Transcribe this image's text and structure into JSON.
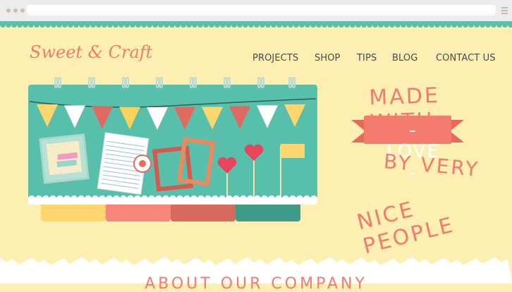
{
  "site": {
    "logo": "Sweet & Craft",
    "nav": [
      "PROJECTS",
      "SHOP",
      "TIPS",
      "BLOG",
      "CONTACT US"
    ]
  },
  "hero": {
    "line1": "MADE WITH",
    "ribbon": "- LOVE -",
    "line2": "BY VERY",
    "line3": "NICE PEOPLE"
  },
  "section": {
    "title": "ABOUT OUR COMPANY"
  },
  "colors": {
    "accent": "#f07b6e",
    "teal": "#58bfaa",
    "background": "#fdefb2",
    "yellow": "#fdd670",
    "coral": "#f7857a",
    "brick": "#d86a5c",
    "green": "#3f9a89"
  },
  "icons": [
    "menu-icon",
    "window-dot"
  ]
}
